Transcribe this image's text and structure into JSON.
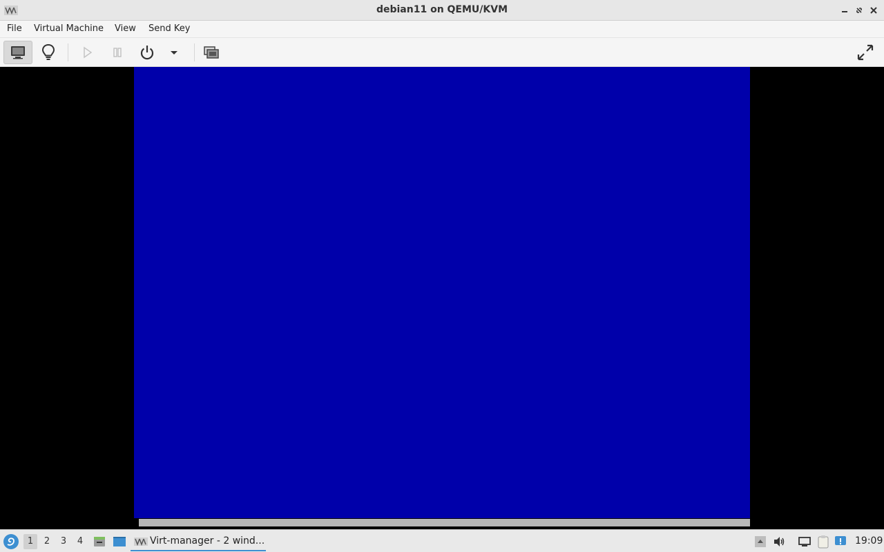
{
  "window": {
    "title": "debian11 on QEMU/KVM",
    "app_icon": "virt-manager-icon",
    "controls": [
      "minimize-icon",
      "maximize-icon",
      "close-icon"
    ]
  },
  "menubar": {
    "items": [
      "File",
      "Virtual Machine",
      "View",
      "Send Key"
    ]
  },
  "toolbar": {
    "buttons": [
      {
        "name": "console-button",
        "icon": "monitor-icon",
        "active": true
      },
      {
        "name": "details-button",
        "icon": "lightbulb-icon",
        "active": false
      },
      {
        "name": "run-button",
        "icon": "play-icon",
        "enabled": false
      },
      {
        "name": "pause-button",
        "icon": "pause-icon",
        "enabled": false
      },
      {
        "name": "shutdown-button",
        "icon": "power-icon",
        "enabled": true
      },
      {
        "name": "shutdown-menu-button",
        "icon": "chevron-down-icon",
        "enabled": true
      },
      {
        "name": "snapshots-button",
        "icon": "snapshots-icon",
        "enabled": true
      },
      {
        "name": "fullscreen-button",
        "icon": "fullscreen-icon",
        "enabled": true
      }
    ]
  },
  "console": {
    "screen_color": "#0000aa",
    "background_color": "#000000"
  },
  "taskbar": {
    "workspaces": [
      "1",
      "2",
      "3",
      "4"
    ],
    "active_workspace": "1",
    "task_label": "Virt-manager - 2 wind...",
    "clock": "19:09",
    "accent": "#3d8fd1"
  }
}
